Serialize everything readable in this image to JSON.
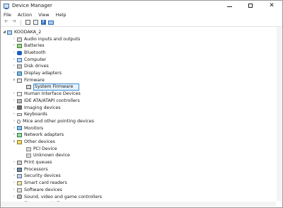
{
  "window": {
    "title": "Device Manager",
    "controls": {
      "minimize": "—",
      "maximize": "□",
      "close": "✕"
    }
  },
  "menu": {
    "file": "File",
    "action": "Action",
    "view": "View",
    "help": "Help"
  },
  "toolbar": {
    "back_icon": "arrow-left",
    "forward_icon": "arrow-right",
    "properties_icon": "properties",
    "help_icon": "help",
    "monitor_icon": "screen"
  },
  "tree": {
    "root": "KOODAKA_2",
    "items": [
      {
        "label": "Audio inputs and outputs",
        "icon": "audio"
      },
      {
        "label": "Batteries",
        "icon": "battery"
      },
      {
        "label": "Bluetooth",
        "icon": "bluetooth"
      },
      {
        "label": "Computer",
        "icon": "computer"
      },
      {
        "label": "Disk drives",
        "icon": "disk"
      },
      {
        "label": "Display adapters",
        "icon": "display"
      },
      {
        "label": "Firmware",
        "icon": "firmware",
        "expanded": true,
        "children": [
          {
            "label": "System Firmware",
            "icon": "chip",
            "selected": true
          }
        ]
      },
      {
        "label": "Human Interface Devices",
        "icon": "hid"
      },
      {
        "label": "IDE ATA/ATAPI controllers",
        "icon": "ide"
      },
      {
        "label": "Imaging devices",
        "icon": "imaging"
      },
      {
        "label": "Keyboards",
        "icon": "keyboard"
      },
      {
        "label": "Mice and other pointing devices",
        "icon": "mouse"
      },
      {
        "label": "Monitors",
        "icon": "monitor"
      },
      {
        "label": "Network adapters",
        "icon": "network"
      },
      {
        "label": "Other devices",
        "icon": "other",
        "expanded": true,
        "children": [
          {
            "label": "PCI Device",
            "icon": "unknown"
          },
          {
            "label": "Unknown device",
            "icon": "unknown"
          }
        ]
      },
      {
        "label": "Print queues",
        "icon": "print"
      },
      {
        "label": "Processors",
        "icon": "processor"
      },
      {
        "label": "Security devices",
        "icon": "security"
      },
      {
        "label": "Smart card readers",
        "icon": "smartcard"
      },
      {
        "label": "Software devices",
        "icon": "software"
      },
      {
        "label": "Sound, video and game controllers",
        "icon": "sound"
      },
      {
        "label": "Storage controllers",
        "icon": "storage"
      }
    ]
  }
}
